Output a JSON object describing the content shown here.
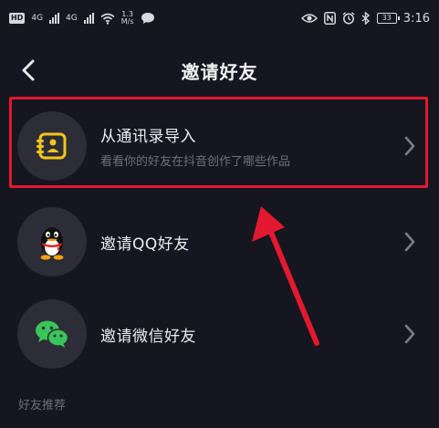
{
  "status_bar": {
    "hd": "HD",
    "sig1": "4G",
    "sig2": "4G",
    "speed_value": "1.3",
    "speed_unit": "M/s",
    "battery": "33",
    "time": "3:16"
  },
  "header": {
    "title": "邀请好友"
  },
  "rows": [
    {
      "label": "从通讯录导入",
      "sub": "看看你的好友在抖音创作了哪些作品"
    },
    {
      "label": "邀请QQ好友"
    },
    {
      "label": "邀请微信好友"
    }
  ],
  "section": {
    "title": "好友推荐"
  },
  "colors": {
    "background": "#15161f",
    "highlight": "#e3192f",
    "contacts_icon": "#f5c518",
    "wechat_green": "#3bc45a"
  }
}
